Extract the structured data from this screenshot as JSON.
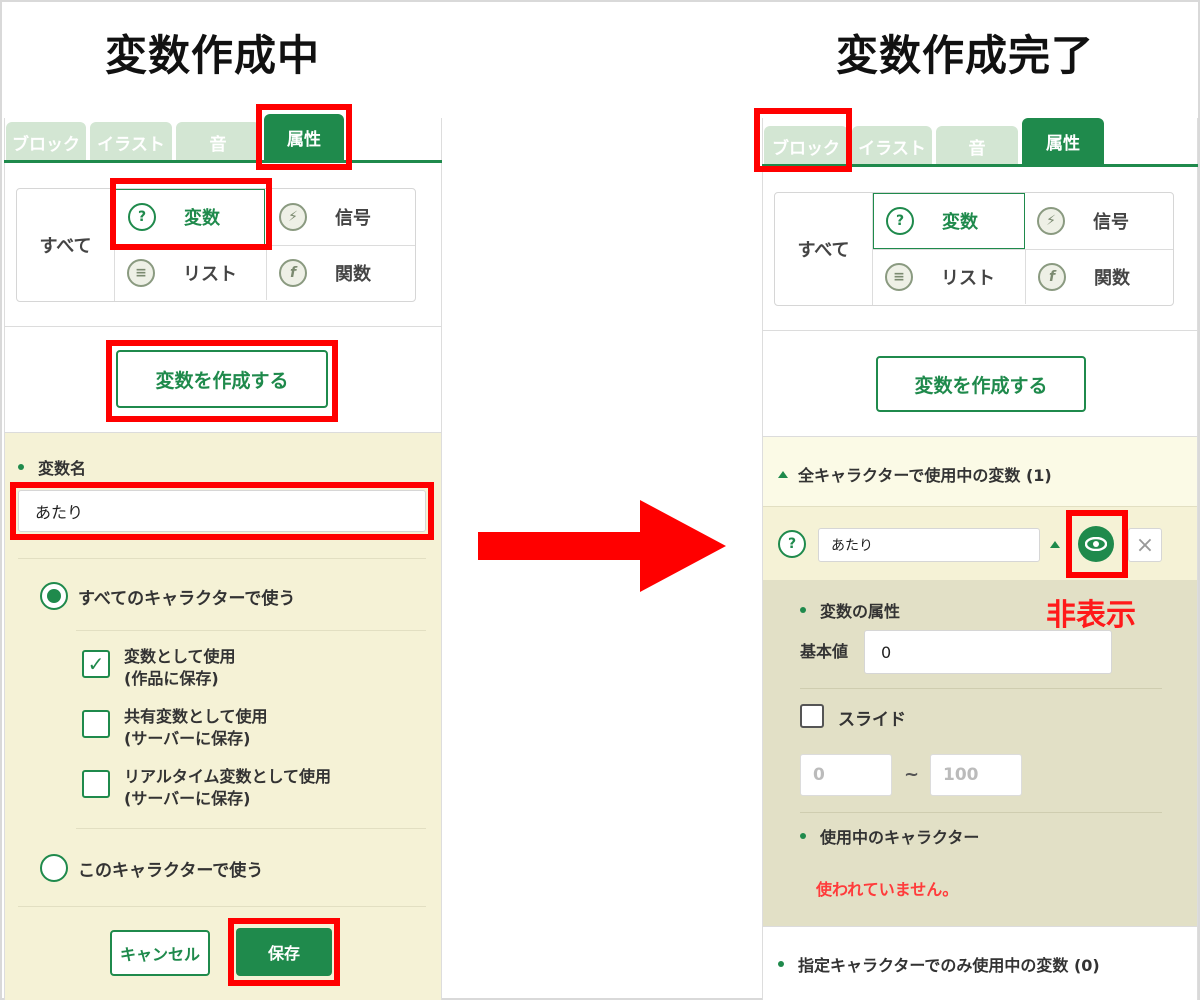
{
  "left_title": "変数作成中",
  "right_title": "変数作成完了",
  "tabs": [
    "ブロック",
    "イラスト",
    "音",
    "属性"
  ],
  "categories": {
    "all": "すべて",
    "variable": "変数",
    "signal": "信号",
    "list": "リスト",
    "function": "関数"
  },
  "create_button": "変数を作成する",
  "form": {
    "name_label": "変数名",
    "name_value": "あたり",
    "radio_all": "すべてのキャラクターで使う",
    "check1_line1": "変数として使用",
    "check1_line2": "(作品に保存)",
    "check2_line1": "共有変数として使用",
    "check2_line2": "(サーバーに保存)",
    "check3_line1": "リアルタイム変数として使用",
    "check3_line2": "(サーバーに保存)",
    "radio_this": "このキャラクターで使う",
    "cancel": "キャンセル",
    "save": "保存"
  },
  "right": {
    "section_all": "全キャラクターで使用中の変数 (1)",
    "var_name": "あたり",
    "hide_label": "非表示",
    "props_label": "変数の属性",
    "default_label": "基本値",
    "default_value": "0",
    "slide_label": "スライド",
    "slide_min": "0",
    "slide_sep": "~",
    "slide_max": "100",
    "chars_label": "使用中のキャラクター",
    "unused": "使われていません。",
    "section_specific": "指定キャラクターでのみ使用中の変数 (0)"
  },
  "colors": {
    "accent": "#1f8a4c",
    "highlight": "#ff0000",
    "form_bg": "#f5f2d6"
  }
}
